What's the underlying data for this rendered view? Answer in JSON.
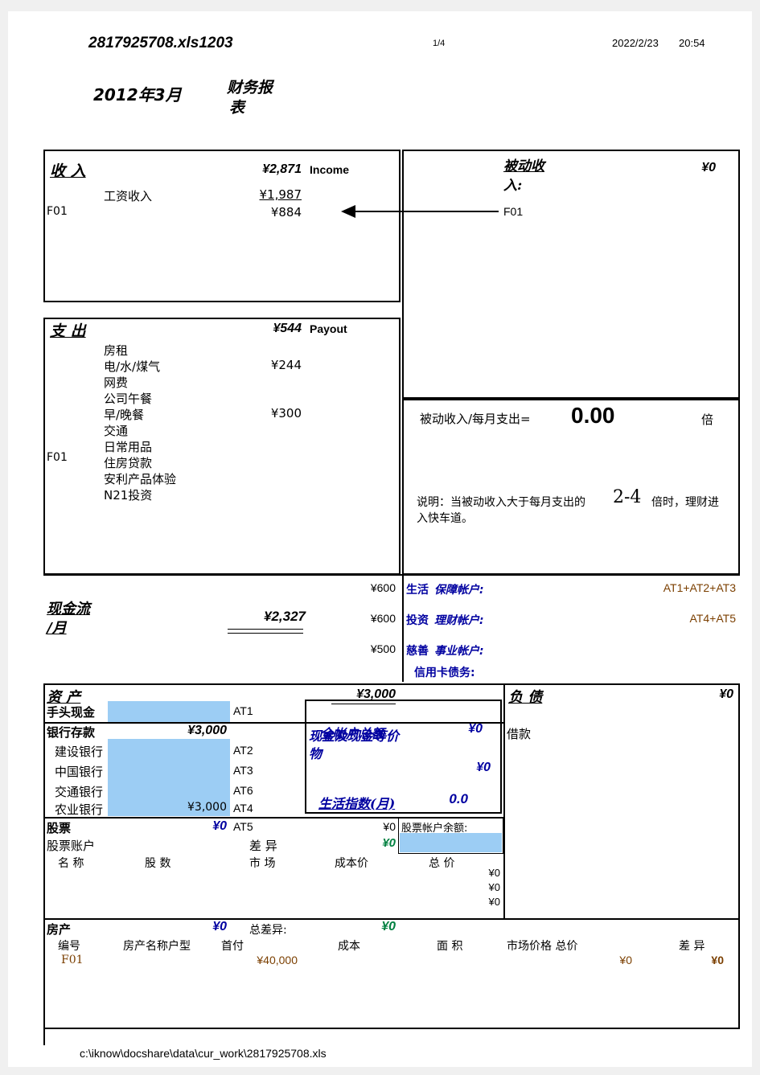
{
  "header": {
    "filename": "2817925708.xls1203",
    "page_indicator": "1/4",
    "date": "2022/2/23",
    "time": "20:54"
  },
  "title": {
    "period": "2012年3月",
    "doc_title_line1": "财务报",
    "doc_title_line2": "表"
  },
  "income": {
    "heading": "收 入",
    "total": "¥2,871",
    "label_en": "Income",
    "code": "F01",
    "items": [
      {
        "name": "工资收入",
        "amount": "¥1,987"
      },
      {
        "name": "",
        "amount": "¥884"
      }
    ]
  },
  "payout": {
    "heading": "支 出",
    "total": "¥544",
    "label_en": "Payout",
    "code": "F01",
    "items": [
      {
        "name": "房租",
        "amount": ""
      },
      {
        "name": "电/水/煤气",
        "amount": "¥244"
      },
      {
        "name": "网费",
        "amount": ""
      },
      {
        "name": "公司午餐",
        "amount": ""
      },
      {
        "name": "早/晚餐",
        "amount": "¥300"
      },
      {
        "name": "交通",
        "amount": ""
      },
      {
        "name": "日常用品",
        "amount": ""
      },
      {
        "name": "住房贷款",
        "amount": ""
      },
      {
        "name": "安利产品体验",
        "amount": ""
      },
      {
        "name": "N21投资",
        "amount": ""
      }
    ]
  },
  "passive_income": {
    "heading_line1": "被动收",
    "heading_line2": "入:",
    "total": "¥0",
    "code": "F01"
  },
  "ratio": {
    "formula_label": "被动收入/每月支出=",
    "value": "0.00",
    "unit": "倍",
    "note_prefix": "说明：当被动收入大于每月支出的",
    "note_value": "2-4",
    "note_suffix": "倍时，理财进",
    "note_line2": "入快车道。"
  },
  "cashflow": {
    "label_line1": "现金流",
    "label_line2": "/月",
    "value": "¥2,327"
  },
  "accounts": [
    {
      "amount": "¥600",
      "name_bold": "生活",
      "name_italic": "保障帐户:",
      "formula": "AT1+AT2+AT3"
    },
    {
      "amount": "¥600",
      "name_bold": "投资",
      "name_italic": "理财帐户:",
      "formula": "AT4+AT5"
    },
    {
      "amount": "¥500",
      "name_bold": "慈善",
      "name_italic": "事业帐户:",
      "formula": ""
    },
    {
      "amount": "",
      "name_bold": "信用卡债务:",
      "name_italic": "",
      "formula": ""
    }
  ],
  "assets": {
    "heading": "资 产",
    "total": "¥3,000",
    "cash_row": {
      "label": "手头现金",
      "value": "",
      "code": "AT1"
    },
    "bank_row": {
      "label": "银行存款",
      "value": "¥3,000"
    },
    "banks": [
      {
        "label": "建设银行",
        "value": "",
        "code": "AT2"
      },
      {
        "label": "中国银行",
        "value": "",
        "code": "AT3"
      },
      {
        "label": "交通银行",
        "value": "",
        "code": "AT6"
      },
      {
        "label": "农业银行",
        "value": "¥3,000",
        "code": "AT4"
      }
    ],
    "stock_row": {
      "label": "股票",
      "value": "¥0",
      "code": "AT5",
      "side_value": "¥0"
    },
    "stock_account": {
      "label": "股票账户",
      "diff_label": "差 异",
      "diff_value": "¥0"
    },
    "stock_balance_label": "股票帐户余额:",
    "stock_balance_value": "",
    "stock_headers": [
      "名 称",
      "股 数",
      "市 场",
      "成本价",
      "总 价"
    ],
    "stock_rows": [
      "¥0",
      "¥0",
      "¥0"
    ]
  },
  "center_box": {
    "overlap_line_a": "全帐户总额",
    "overlap_line_b1": "现金及现金等价",
    "overlap_line_b2": "物",
    "value_top": "¥0",
    "value_mid": "¥0",
    "index_label": "生活指数(月)",
    "index_value": "0.0"
  },
  "liabilities": {
    "heading": "负 债",
    "total": "¥0",
    "item": "借款"
  },
  "property": {
    "heading": "房产",
    "value": "¥0",
    "diff_label": "总差异:",
    "diff_value": "¥0",
    "headers": [
      "编号",
      "房产名称户型",
      "首付",
      "成本",
      "面 积",
      "市场价格 总价",
      "差 异"
    ],
    "row": {
      "id": "F01",
      "name": "",
      "downpay": "¥40,000",
      "cost": "",
      "area": "",
      "market": "¥0",
      "diff": "¥0"
    }
  },
  "footer": {
    "path": "c:\\iknow\\docshare\\data\\cur_work\\2817925708.xls"
  }
}
